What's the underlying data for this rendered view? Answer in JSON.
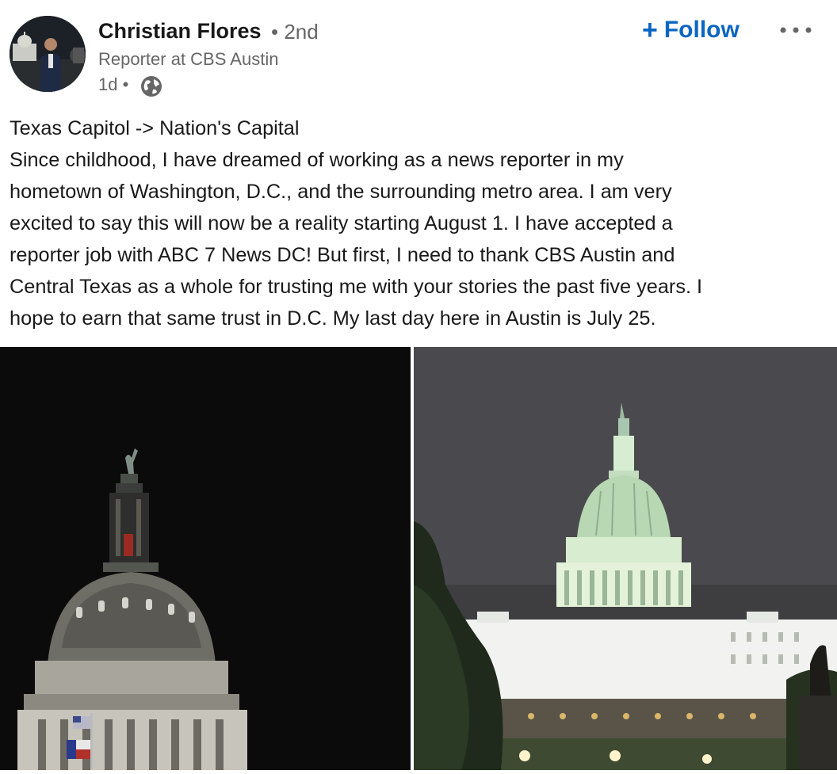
{
  "author": {
    "name": "Christian Flores",
    "degree": "• 2nd",
    "headline": "Reporter at CBS Austin",
    "time": "1d •",
    "visibility_icon": "globe-icon"
  },
  "actions": {
    "follow_label": "Follow",
    "follow_icon": "plus-icon",
    "more_icon": "more-horizontal-icon"
  },
  "post": {
    "lines": [
      "Texas Capitol -> Nation's Capital",
      "Since childhood, I have dreamed of working as a news reporter in my",
      "hometown of Washington, D.C., and the surrounding metro area. I am very",
      "excited to say this will now be a reality starting August 1. I have accepted a",
      "reporter job with ABC 7 News DC! But first, I need to thank CBS Austin and",
      "Central Texas as a whole for trusting me with your stories the past five years. I",
      "hope to earn that same trust in D.C. My last day here in Austin is July 25."
    ]
  },
  "colors": {
    "accent": "#0a66c2",
    "text": "#191919",
    "muted": "#666666"
  }
}
